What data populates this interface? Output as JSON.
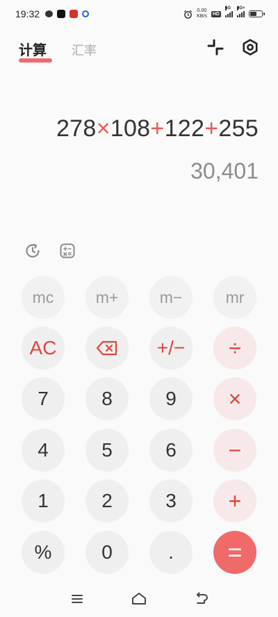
{
  "status_bar": {
    "time": "19:32",
    "net_speed_value": "0.00",
    "net_speed_unit": "KB/s",
    "hd_label": "HD",
    "signal1_label": "5G",
    "signal2_label": "4G+"
  },
  "tabs": [
    {
      "label": "计算",
      "active": true
    },
    {
      "label": "汇率",
      "active": false
    }
  ],
  "header_icons": [
    "minimize-icon",
    "settings-icon"
  ],
  "display": {
    "expression": [
      {
        "text": "278",
        "op": false
      },
      {
        "text": "×",
        "op": true
      },
      {
        "text": "108",
        "op": false
      },
      {
        "text": "+",
        "op": true
      },
      {
        "text": "122",
        "op": false
      },
      {
        "text": "+",
        "op": true
      },
      {
        "text": "255",
        "op": false
      }
    ],
    "result": "30,401"
  },
  "tools": [
    "history-icon",
    "unit-convert-icon"
  ],
  "keys": [
    {
      "label": "mc",
      "type": "mem",
      "name": "key-mc"
    },
    {
      "label": "m+",
      "type": "mem",
      "name": "key-m-plus"
    },
    {
      "label": "m−",
      "type": "mem",
      "name": "key-m-minus"
    },
    {
      "label": "mr",
      "type": "mem",
      "name": "key-mr"
    },
    {
      "label": "AC",
      "type": "func",
      "name": "key-ac"
    },
    {
      "label": "",
      "type": "func",
      "name": "key-backspace",
      "icon": "backspace-icon"
    },
    {
      "label": "+/−",
      "type": "func",
      "name": "key-sign"
    },
    {
      "label": "÷",
      "type": "op",
      "name": "key-divide"
    },
    {
      "label": "7",
      "type": "digit",
      "name": "key-7"
    },
    {
      "label": "8",
      "type": "digit",
      "name": "key-8"
    },
    {
      "label": "9",
      "type": "digit",
      "name": "key-9"
    },
    {
      "label": "×",
      "type": "op",
      "name": "key-multiply"
    },
    {
      "label": "4",
      "type": "digit",
      "name": "key-4"
    },
    {
      "label": "5",
      "type": "digit",
      "name": "key-5"
    },
    {
      "label": "6",
      "type": "digit",
      "name": "key-6"
    },
    {
      "label": "−",
      "type": "op",
      "name": "key-minus"
    },
    {
      "label": "1",
      "type": "digit",
      "name": "key-1"
    },
    {
      "label": "2",
      "type": "digit",
      "name": "key-2"
    },
    {
      "label": "3",
      "type": "digit",
      "name": "key-3"
    },
    {
      "label": "+",
      "type": "op",
      "name": "key-plus"
    },
    {
      "label": "%",
      "type": "digit",
      "name": "key-percent"
    },
    {
      "label": "0",
      "type": "digit",
      "name": "key-0"
    },
    {
      "label": ".",
      "type": "digit",
      "name": "key-decimal"
    },
    {
      "label": "=",
      "type": "eq",
      "name": "key-equals"
    }
  ],
  "colors": {
    "accent": "#ee6b6e",
    "operator": "#e0443e",
    "operator_bg": "#f7e9e9",
    "key_bg": "#efefef"
  },
  "nav": [
    "menu-icon",
    "home-icon",
    "back-icon"
  ]
}
